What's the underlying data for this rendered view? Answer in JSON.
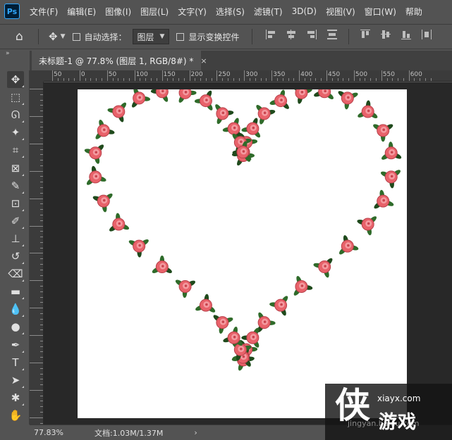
{
  "app": {
    "logo_text": "Ps",
    "menu": [
      "文件(F)",
      "编辑(E)",
      "图像(I)",
      "图层(L)",
      "文字(Y)",
      "选择(S)",
      "滤镜(T)",
      "3D(D)",
      "视图(V)",
      "窗口(W)",
      "帮助"
    ]
  },
  "options": {
    "home_icon": "home-icon",
    "move_icon": "move-icon",
    "auto_select_label": "自动选择：",
    "auto_select_checked": false,
    "auto_select_target": "图层",
    "show_transform_label": "显示变换控件",
    "show_transform_checked": false,
    "collapse_label": "»"
  },
  "document": {
    "tab_title": "未标题-1 @ 77.8% (图层 1, RGB/8#) *",
    "close_label": "×"
  },
  "ruler": {
    "h_labels": [
      "50",
      "0",
      "50",
      "100",
      "150",
      "200",
      "250",
      "300",
      "350",
      "400",
      "450",
      "500",
      "550",
      "600"
    ]
  },
  "tools": [
    {
      "name": "move-tool",
      "glyph": "✥",
      "active": true
    },
    {
      "name": "marquee-tool",
      "glyph": "⬚"
    },
    {
      "name": "lasso-tool",
      "glyph": "ᘏ"
    },
    {
      "name": "magic-wand-tool",
      "glyph": "✦"
    },
    {
      "name": "crop-tool",
      "glyph": "⌗"
    },
    {
      "name": "frame-tool",
      "glyph": "⊠"
    },
    {
      "name": "eyedropper-tool",
      "glyph": "✎"
    },
    {
      "name": "healing-brush-tool",
      "glyph": "⊡"
    },
    {
      "name": "brush-tool",
      "glyph": "✐"
    },
    {
      "name": "clone-stamp-tool",
      "glyph": "⊥"
    },
    {
      "name": "history-brush-tool",
      "glyph": "↺"
    },
    {
      "name": "eraser-tool",
      "glyph": "⌫"
    },
    {
      "name": "gradient-tool",
      "glyph": "▬"
    },
    {
      "name": "blur-tool",
      "glyph": "💧"
    },
    {
      "name": "dodge-tool",
      "glyph": "●"
    },
    {
      "name": "pen-tool",
      "glyph": "✒"
    },
    {
      "name": "type-tool",
      "glyph": "T"
    },
    {
      "name": "path-selection-tool",
      "glyph": "➤"
    },
    {
      "name": "custom-shape-tool",
      "glyph": "✱"
    },
    {
      "name": "hand-tool",
      "glyph": "✋"
    }
  ],
  "status": {
    "zoom": "77.83%",
    "doc_info": "文档:1.03M/1.37M",
    "arrow": "›"
  },
  "watermark": {
    "logo_char": "侠",
    "url": "xiayx.com",
    "name": "游戏",
    "faint_text": "jingyan.baidu.com"
  },
  "colors": {
    "ui_bg": "#535353",
    "workspace_bg": "#282828",
    "rose": "#e8626a",
    "leaf": "#2f6b2a"
  }
}
